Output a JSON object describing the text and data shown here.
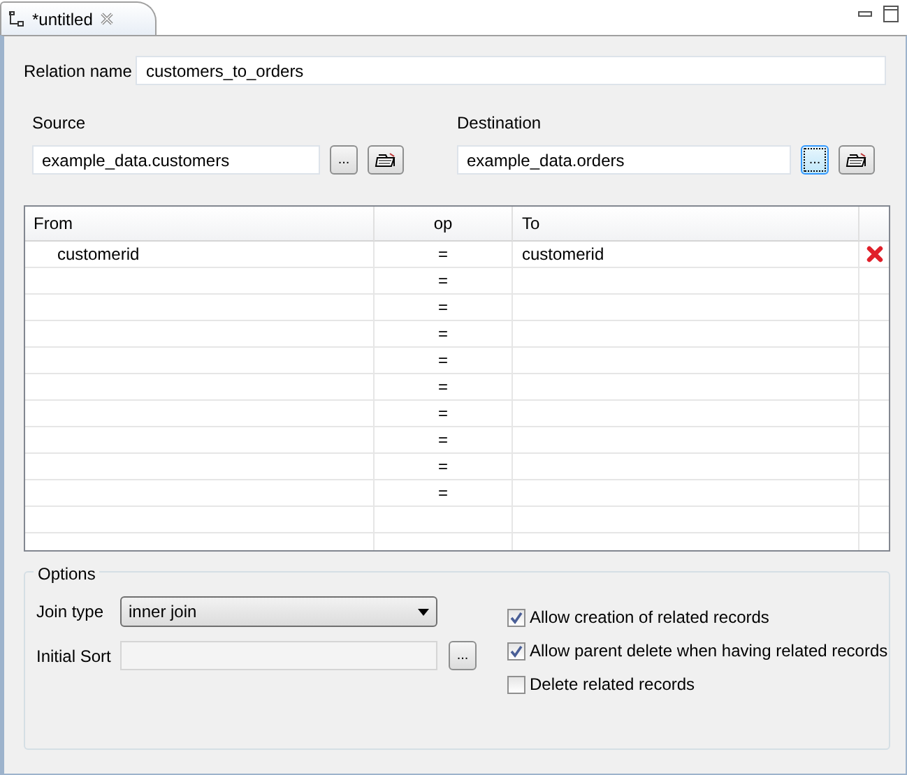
{
  "tab": {
    "title": "*untitled"
  },
  "relation_name": {
    "label": "Relation name",
    "value": "customers_to_orders"
  },
  "source": {
    "label": "Source",
    "value": "example_data.customers",
    "browse": {
      "label": "...",
      "focused": false
    }
  },
  "destination": {
    "label": "Destination",
    "value": "example_data.orders",
    "browse": {
      "label": "...",
      "focused": true
    }
  },
  "table": {
    "columns": [
      "From",
      "op",
      "To"
    ],
    "rows": [
      {
        "from": "customerid",
        "op": "=",
        "to": "customerid",
        "deletable": true
      },
      {
        "op": "=",
        "deletable": false
      },
      {
        "op": "=",
        "deletable": false
      },
      {
        "op": "=",
        "deletable": false
      },
      {
        "op": "=",
        "deletable": false
      },
      {
        "op": "=",
        "deletable": false
      },
      {
        "op": "=",
        "deletable": false
      },
      {
        "op": "=",
        "deletable": false
      },
      {
        "op": "=",
        "deletable": false
      },
      {
        "op": "=",
        "deletable": false
      }
    ]
  },
  "options": {
    "title": "Options",
    "join_type": {
      "label": "Join type",
      "value": "inner join"
    },
    "initial_sort": {
      "label": "Initial Sort",
      "browse": "..."
    },
    "checkboxes": [
      {
        "label": "Allow creation of related records",
        "checked": true
      },
      {
        "label": "Allow parent delete when having related records",
        "checked": true
      },
      {
        "label": "Delete related records",
        "checked": false
      }
    ]
  }
}
